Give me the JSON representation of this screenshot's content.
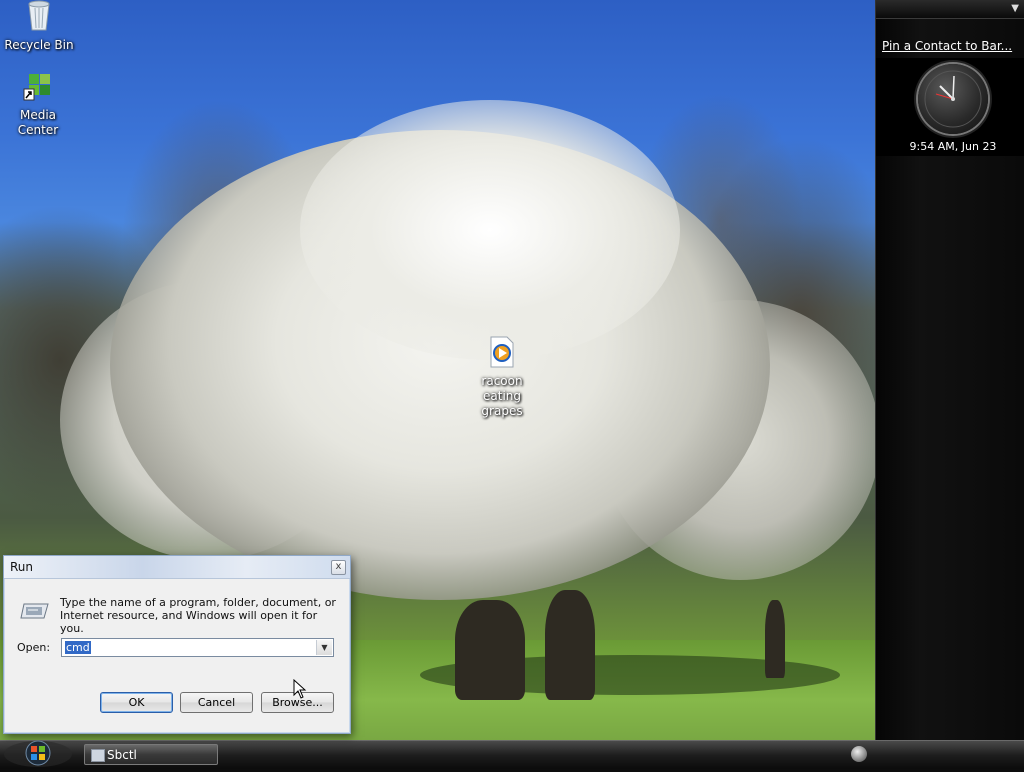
{
  "desktop": {
    "icons": [
      {
        "label": "Recycle Bin",
        "icon": "recycle-bin-icon"
      },
      {
        "label": "Media Center",
        "icon": "media-center-icon"
      },
      {
        "label": "racoon eating grapes",
        "icon": "media-file-icon"
      }
    ]
  },
  "sidebar": {
    "pin_contact_link": "Pin a Contact to Bar...",
    "clock_time": "9:54 AM, Jun 23"
  },
  "taskbar": {
    "start_icon": "windows-orb-icon",
    "task_button_label": "Sbctl",
    "tray_icon": "network-icon"
  },
  "run_dialog": {
    "title": "Run",
    "close_glyph": "x",
    "description": "Type the name of a program, folder, document, or Internet resource, and Windows will open it for you.",
    "open_label": "Open:",
    "open_value": "cmd",
    "ok_label": "OK",
    "cancel_label": "Cancel",
    "browse_label": "Browse..."
  }
}
